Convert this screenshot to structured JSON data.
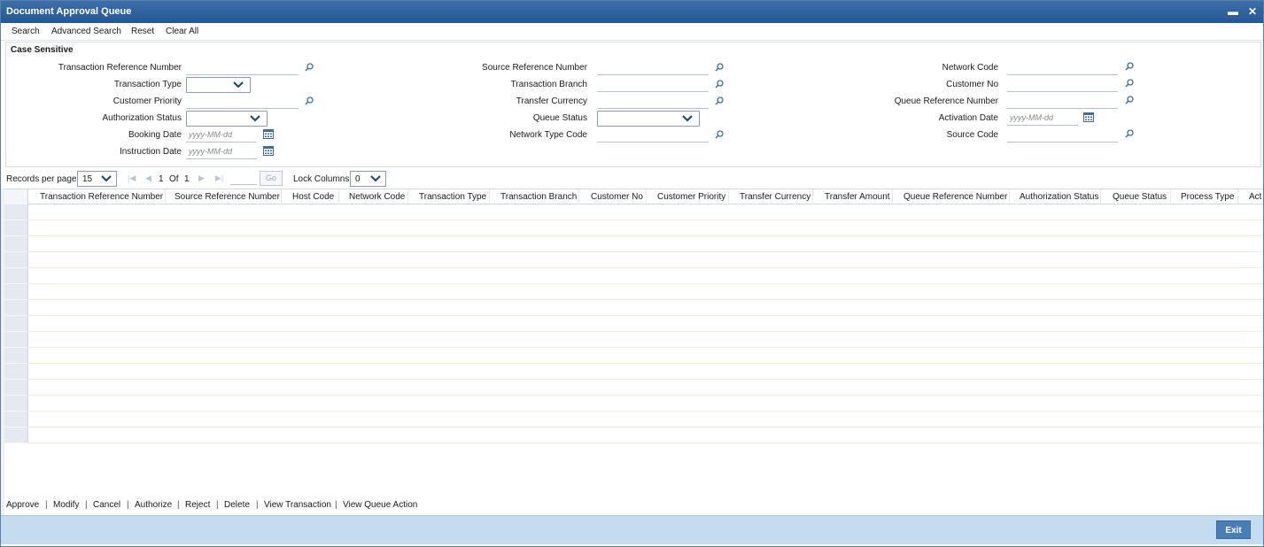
{
  "window": {
    "title": "Document Approval Queue",
    "minimize_glyph": "▬",
    "close_glyph": "✕"
  },
  "toolbar": [
    "Search",
    "Advanced Search",
    "Reset",
    "Clear All"
  ],
  "search": {
    "case_sensitive": "Case Sensitive",
    "col1": {
      "txn_ref": "Transaction Reference Number",
      "txn_type": "Transaction Type",
      "cust_priority": "Customer Priority",
      "auth_status": "Authorization Status",
      "booking_date": "Booking Date",
      "instruction_date": "Instruction Date"
    },
    "col2": {
      "src_ref": "Source Reference Number",
      "txn_branch": "Transaction Branch",
      "transfer_currency": "Transfer Currency",
      "queue_status": "Queue Status",
      "network_type_code": "Network Type Code"
    },
    "col3": {
      "network_code": "Network Code",
      "customer_no": "Customer No",
      "queue_ref": "Queue Reference Number",
      "activation_date": "Activation Date",
      "source_code": "Source Code"
    },
    "date_placeholder": "yyyy-MM-dd"
  },
  "pager": {
    "records_label": "Records per page",
    "records_value": "15",
    "current_page": "1",
    "of_label": "Of",
    "total_pages": "1",
    "go_label": "Go",
    "lock_label": "Lock Columns",
    "lock_value": "0"
  },
  "grid": {
    "columns": [
      "Transaction Reference Number",
      "Source Reference Number",
      "Host Code",
      "Network Code",
      "Transaction Type",
      "Transaction Branch",
      "Customer No",
      "Customer Priority",
      "Transfer Currency",
      "Transfer Amount",
      "Queue Reference Number",
      "Authorization Status",
      "Queue Status",
      "Process Type",
      "Act"
    ],
    "row_count": 15
  },
  "actions": [
    "Approve",
    "Modify",
    "Cancel",
    "Authorize",
    "Reject",
    "Delete",
    "View Transaction",
    "View Queue Action"
  ],
  "footer": {
    "exit_label": "Exit"
  },
  "colors": {
    "title_bar": "#245894",
    "footer": "#c5dcf0",
    "exit_button": "#4a7fb5"
  },
  "icons": {
    "search_field_icon": "magnifier-icon",
    "date_field_icon": "calendar-icon",
    "dropdown_icon": "chevron-down-icon"
  }
}
